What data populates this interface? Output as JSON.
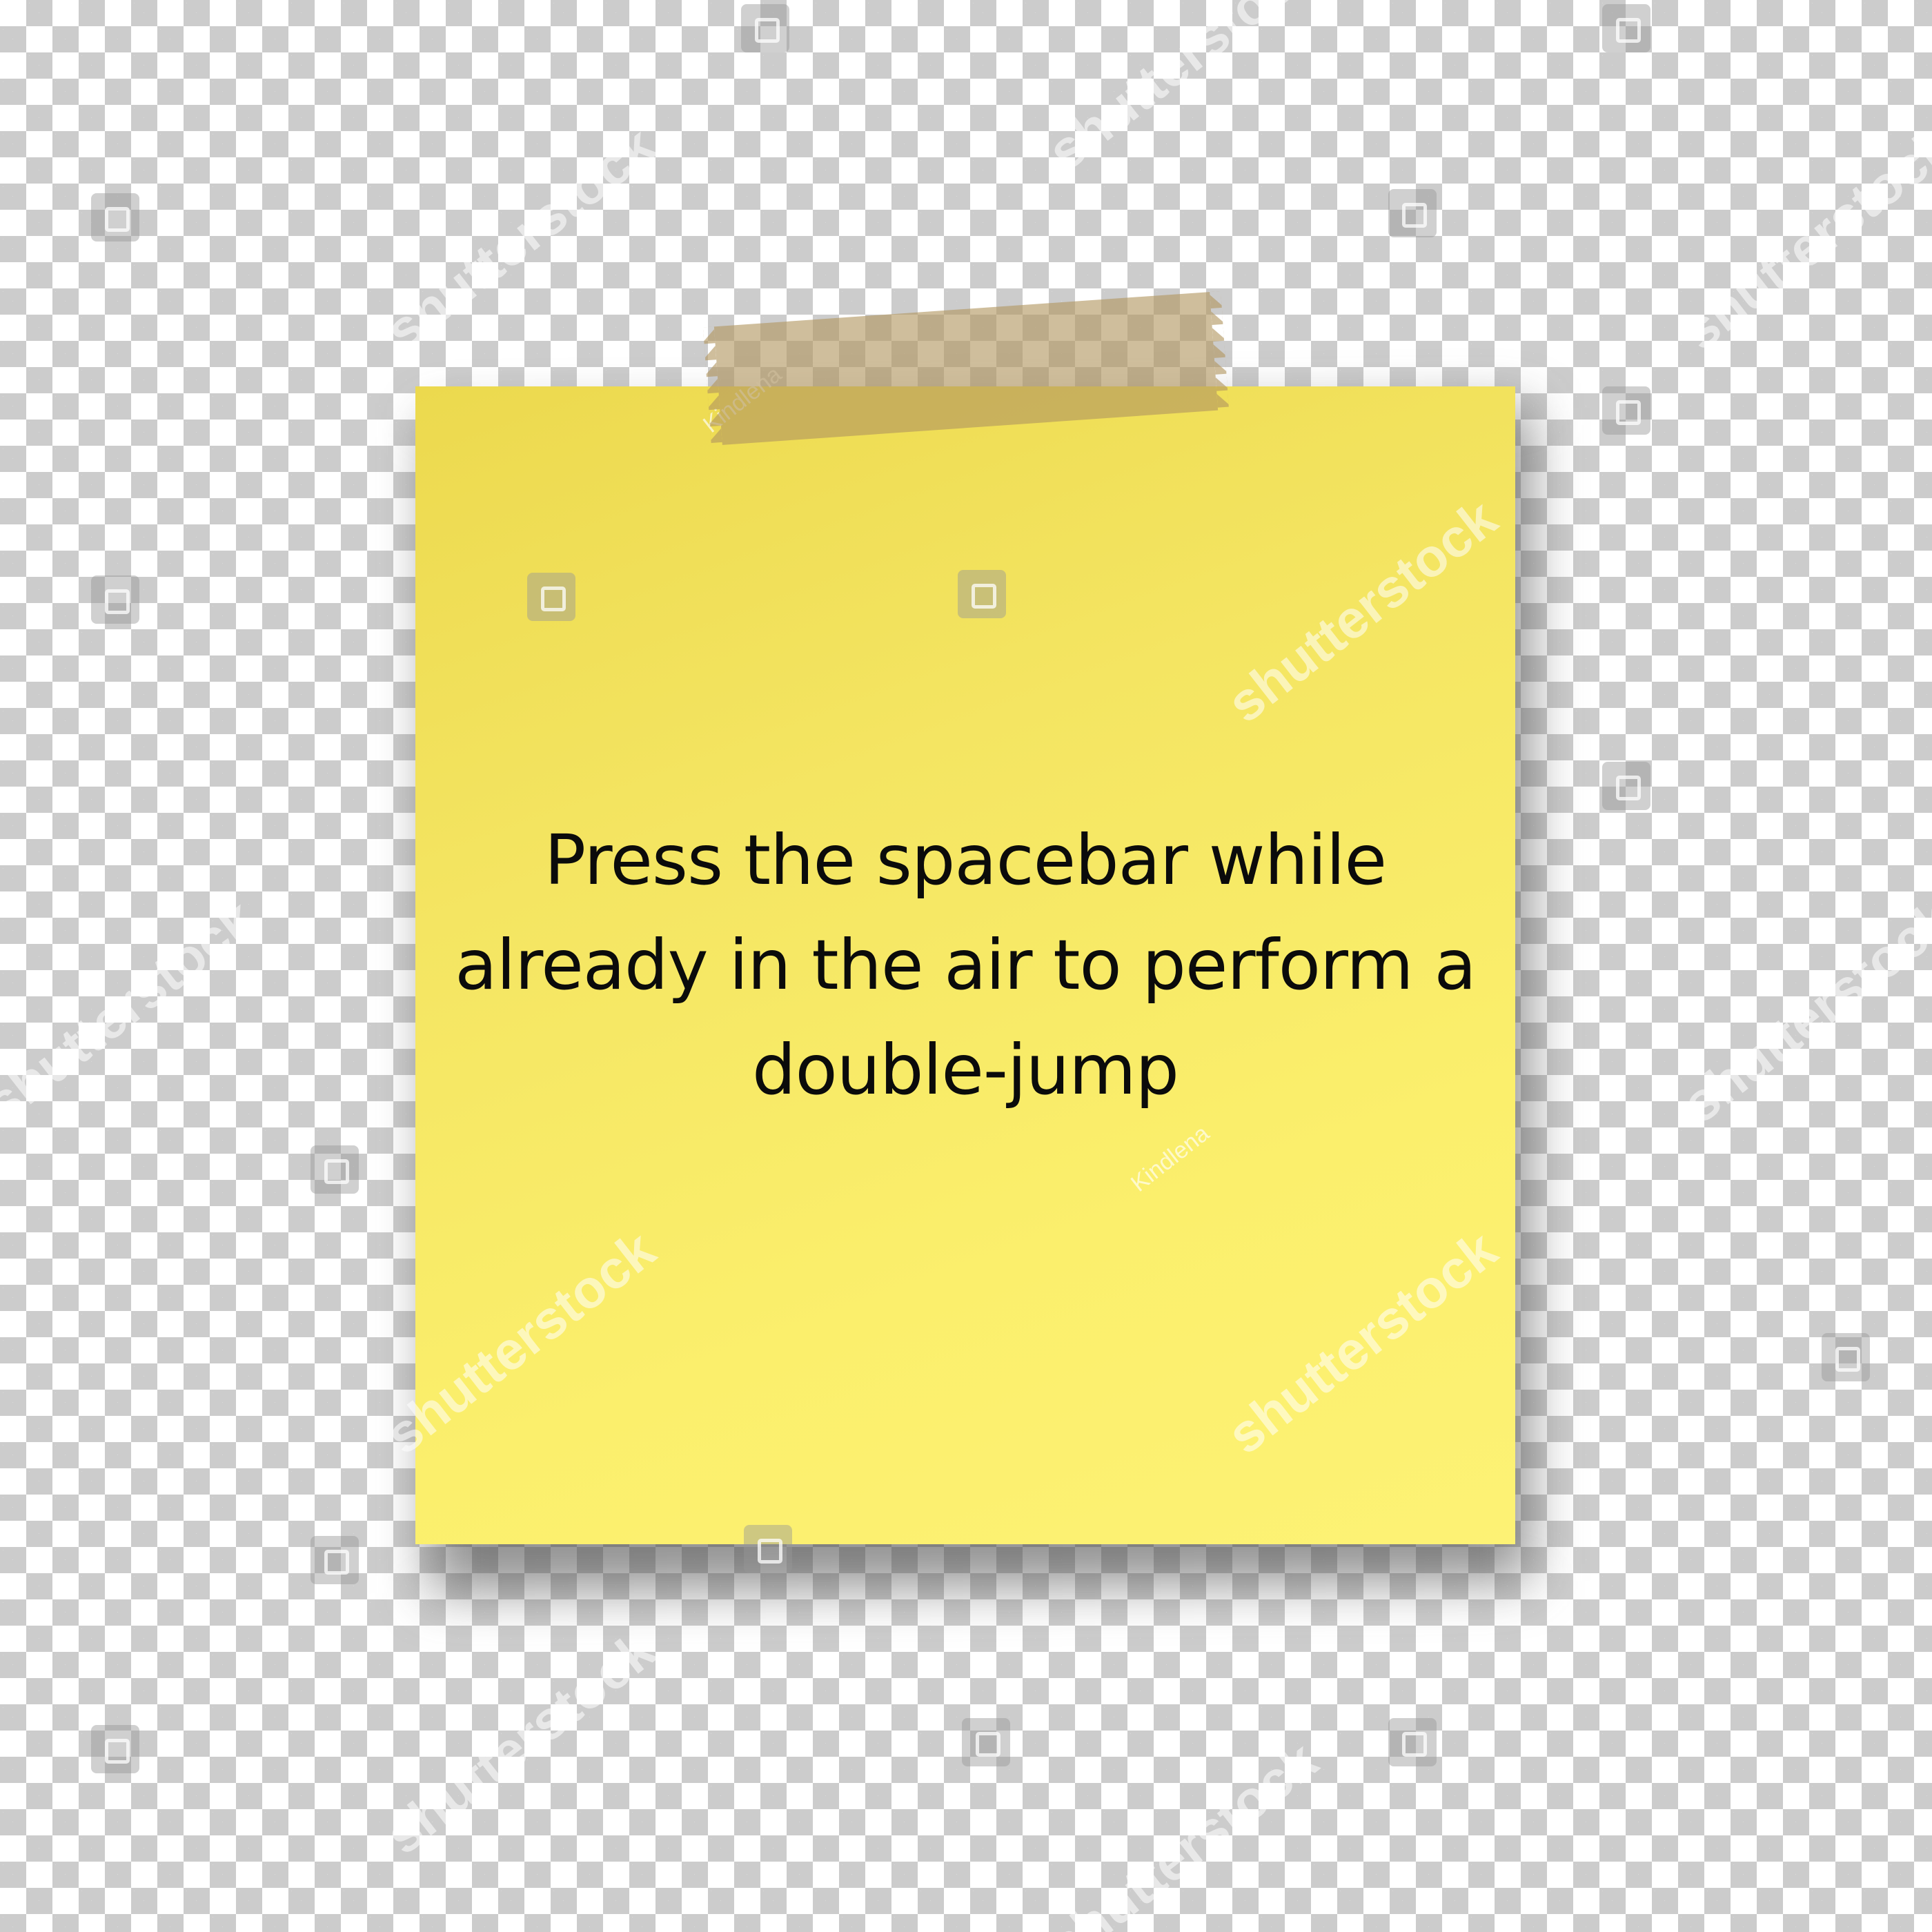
{
  "note": {
    "text": "Press the spacebar while already in the air to perform a double-jump",
    "color": "#fbef6c"
  },
  "tape": {
    "author": "Kindlena"
  },
  "watermark": {
    "brand": "shutterstock"
  },
  "background": {
    "pattern": "transparency-checkerboard",
    "colors": [
      "#ffffff",
      "#cccccc"
    ]
  }
}
